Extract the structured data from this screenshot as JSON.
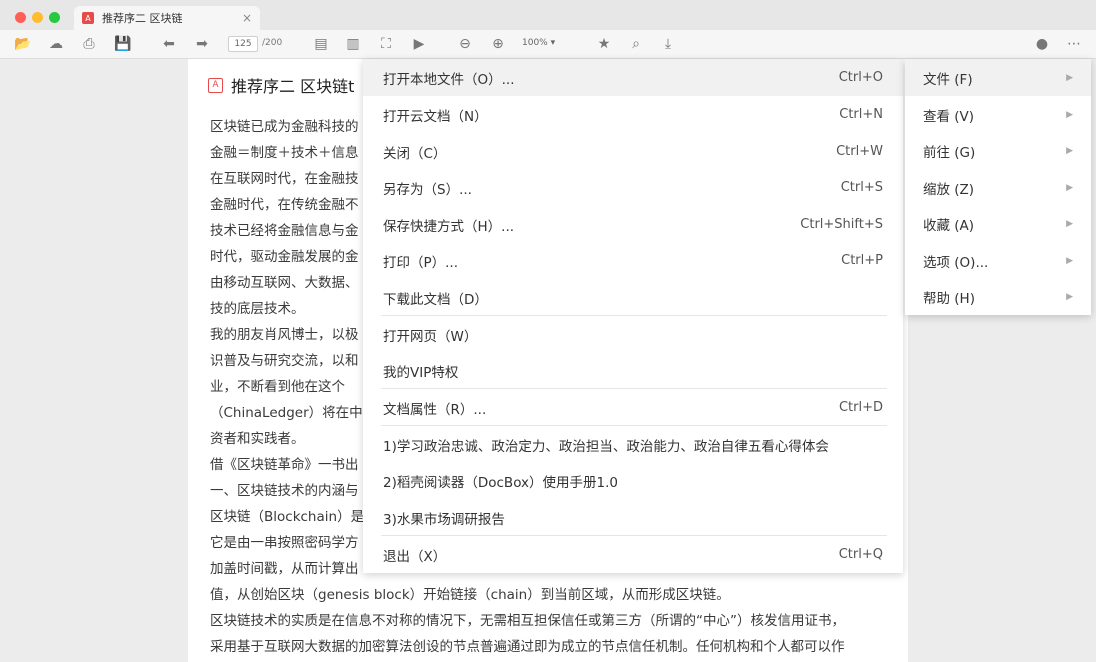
{
  "tab": {
    "title": "推荐序二 区块链",
    "close": "×",
    "pdf_icon": "A"
  },
  "toolbar": {
    "page_current": "125",
    "page_total": "/200",
    "zoom": "100%",
    "icons": {
      "open": "📂",
      "save-cloud": "☁",
      "print": "⎙",
      "save": "💾",
      "back": "⬅",
      "forward": "➡",
      "single-page": "▤",
      "double-page": "▥",
      "fit": "⛶",
      "present": "▶",
      "zoom-out": "⊖",
      "zoom-in": "⊕",
      "star": "★",
      "search": "⌕",
      "download": "⤓",
      "user": "●",
      "more": "⋯",
      "zoom-arrow": "▾"
    }
  },
  "document": {
    "title": "推荐序二 区块链t",
    "title_icon": "A",
    "lines": [
      "区块链已成为金融科技的",
      "金融＝制度＋技术＋信息",
      "在互联网时代，在金融技",
      "金融时代，在传统金融不",
      "技术已经将金融信息与金",
      "时代，驱动金融发展的金",
      "由移动互联网、大数据、",
      "技的底层技术。",
      "我的朋友肖风博士，以极",
      "识普及与研究交流，以和",
      "业，不断看到他在这个",
      "（ChinaLedger）将在中",
      "资者和实践者。",
      "借《区块链革命》一书出",
      "一、区块链技术的内涵与",
      "区块链（Blockchain）是",
      "它是由一串按照密码学方",
      "加盖时间戳，从而计算出",
      "值，从创始区块（genesis block）开始链接（chain）到当前区域，从而形成区块链。",
      "区块链技术的实质是在信息不对称的情况下，无需相互担保信任或第三方（所谓的“中心”）核发信用证书，",
      "采用基于互联网大数据的加密算法创设的节点普遍通过即为成立的节点信任机制。任何机构和个人都可以作"
    ]
  },
  "file_menu": {
    "items": [
      {
        "label": "打开本地文件（O）...",
        "shortcut": "Ctrl+O"
      },
      {
        "label": "打开云文档（N）",
        "shortcut": "Ctrl+N"
      },
      {
        "label": "关闭（C）",
        "shortcut": "Ctrl+W"
      },
      {
        "label": "另存为（S）...",
        "shortcut": "Ctrl+S"
      },
      {
        "label": "保存快捷方式（H）...",
        "shortcut": "Ctrl+Shift+S"
      },
      {
        "label": "打印（P）...",
        "shortcut": "Ctrl+P"
      },
      {
        "label": "下载此文档（D）",
        "shortcut": ""
      },
      {
        "label": "打开网页（W）",
        "shortcut": ""
      },
      {
        "label": "我的VIP特权",
        "shortcut": ""
      },
      {
        "label": "文档属性（R）...",
        "shortcut": "Ctrl+D"
      },
      {
        "label": "1)学习政治忠诚、政治定力、政治担当、政治能力、政治自律五看心得体会",
        "shortcut": ""
      },
      {
        "label": "2)稻壳阅读器（DocBox）使用手册1.0",
        "shortcut": ""
      },
      {
        "label": "3)水果市场调研报告",
        "shortcut": ""
      },
      {
        "label": "退出（X）",
        "shortcut": "Ctrl+Q"
      }
    ]
  },
  "side_menu": {
    "items": [
      {
        "label": "文件 (F)"
      },
      {
        "label": "查看 (V)"
      },
      {
        "label": "前往 (G)"
      },
      {
        "label": "缩放 (Z)"
      },
      {
        "label": "收藏 (A)"
      },
      {
        "label": "选项 (O)..."
      },
      {
        "label": "帮助 (H)"
      }
    ],
    "arrow": "▶"
  }
}
